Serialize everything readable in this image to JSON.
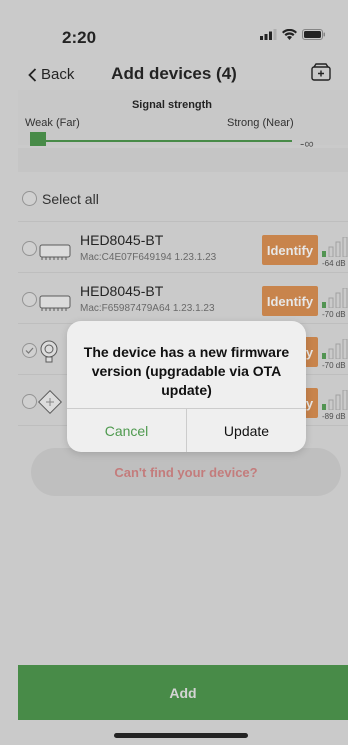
{
  "status": {
    "time": "2:20"
  },
  "nav": {
    "back_label": "Back",
    "title": "Add devices (4)"
  },
  "signal": {
    "title": "Signal strength",
    "weak_label": "Weak (Far)",
    "strong_label": "Strong (Near)",
    "infinity_label": "-∞"
  },
  "select_all_label": "Select all",
  "identify_label": "Identify",
  "devices": [
    {
      "name": "HED8045-BT",
      "mac": "Mac:C4E07F649194  1.23.1.23",
      "dbm": "-64 dB"
    },
    {
      "name": "HED8045-BT",
      "mac": "Mac:F65987479A64  1.23.1.23",
      "dbm": "-70 dB"
    },
    {
      "name": "",
      "mac": "",
      "dbm": "-70 dB"
    },
    {
      "name": "",
      "mac": "",
      "dbm": "-89 dB"
    }
  ],
  "cant_find_label": "Can't find your device?",
  "modal": {
    "message": "The device has a new firmware version (upgradable via OTA update)",
    "cancel_label": "Cancel",
    "update_label": "Update"
  },
  "add_label": "Add",
  "colors": {
    "accent_green": "#3e8f3e",
    "identify_orange": "#d98743",
    "cancel_green": "#4f9a4f",
    "cant_find_red": "#d47d7d"
  }
}
